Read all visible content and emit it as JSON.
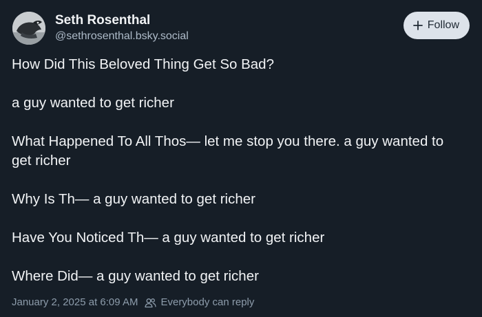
{
  "author": {
    "display_name": "Seth Rosenthal",
    "handle": "@sethrosenthal.bsky.social",
    "avatar_icon": "avatar-bird-photo"
  },
  "follow_button": {
    "label": "Follow",
    "icon": "plus-icon"
  },
  "post": {
    "paragraphs": [
      "How Did This Beloved Thing Get So Bad?",
      "a guy wanted to get richer",
      "What Happened To All Thos— let me stop you there. a guy wanted to get richer",
      "Why Is Th— a guy wanted to get richer",
      "Have You Noticed Th— a guy wanted to get richer",
      "Where Did— a guy wanted to get richer"
    ]
  },
  "meta": {
    "timestamp": "January 2, 2025 at 6:09 AM",
    "reply_setting": "Everybody can reply",
    "reply_icon": "people-icon"
  },
  "colors": {
    "background": "#161e27",
    "text": "#f1f3f5",
    "muted": "#8d9cab",
    "button_bg": "#dde3ea"
  }
}
